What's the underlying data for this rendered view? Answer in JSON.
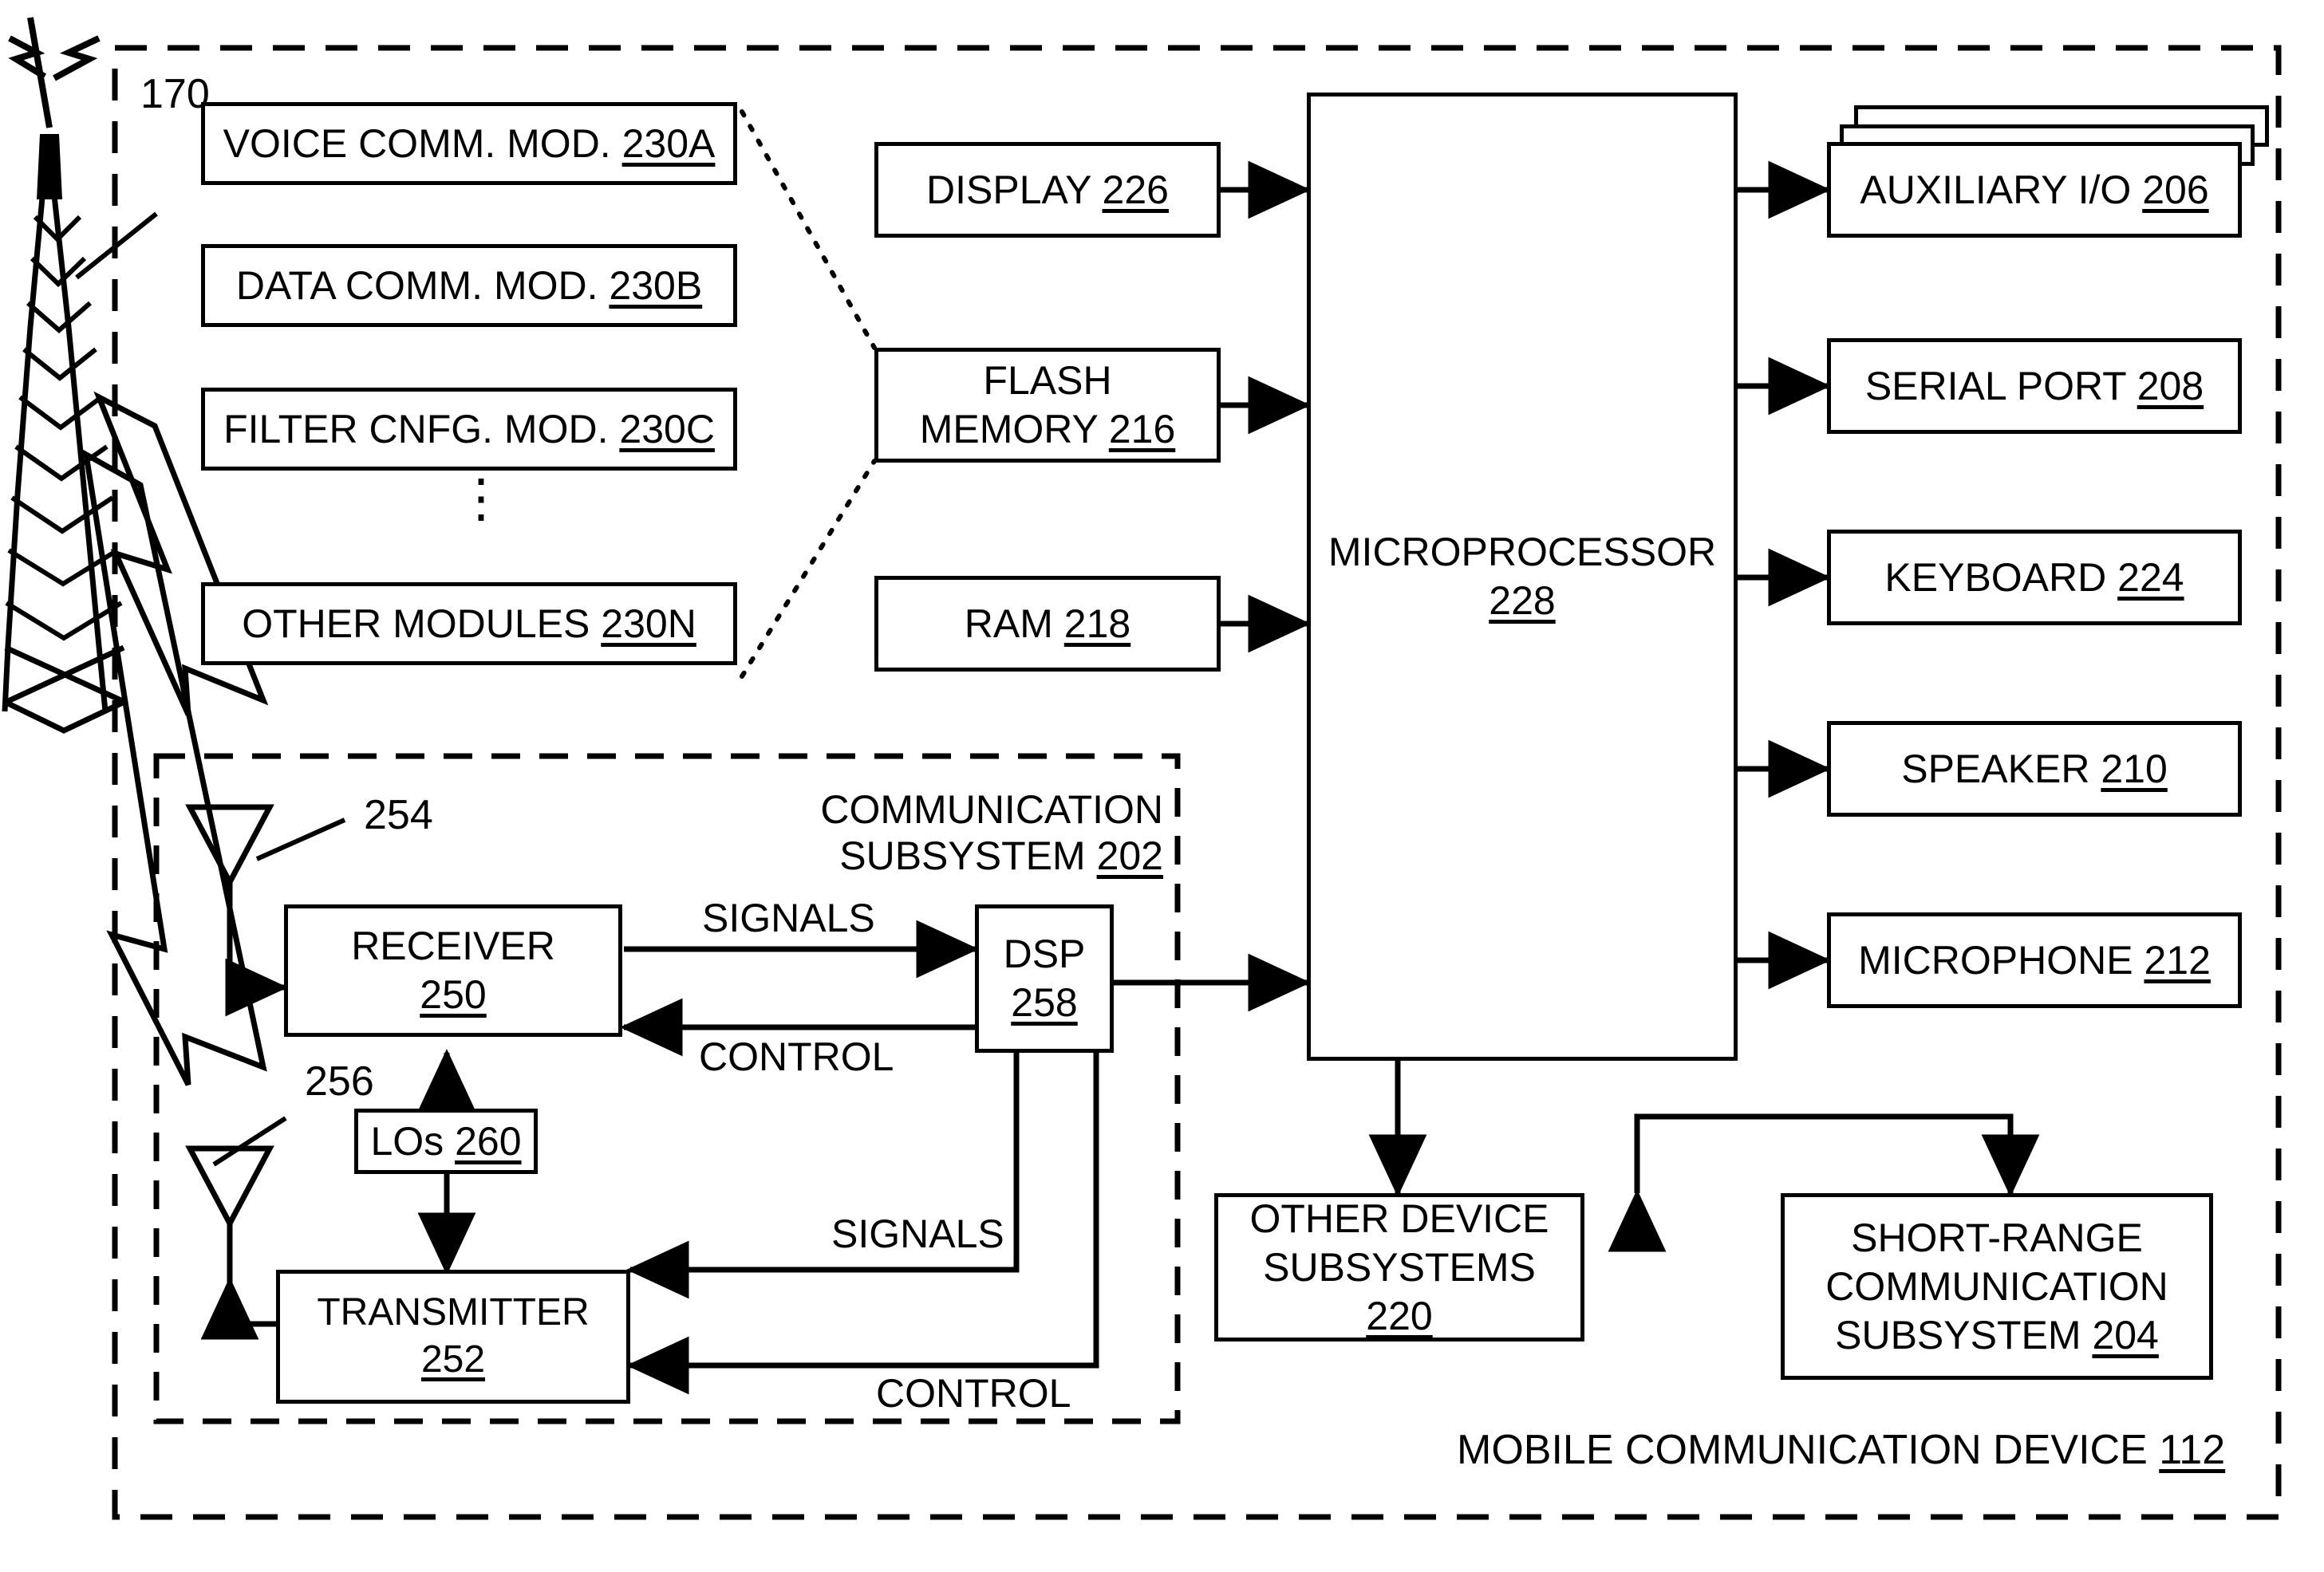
{
  "figure": {
    "outer_device_label": "MOBILE COMMUNICATION DEVICE",
    "outer_device_ref": "112",
    "tower_ref": "170",
    "comm_subsystem_line1": "COMMUNICATION",
    "comm_subsystem_line2": "SUBSYSTEM",
    "comm_subsystem_ref": "202"
  },
  "modules": [
    {
      "label": "VOICE COMM. MOD.",
      "ref": "230A"
    },
    {
      "label": "DATA COMM. MOD.",
      "ref": "230B"
    },
    {
      "label": "FILTER CNFG. MOD.",
      "ref": "230C"
    },
    {
      "label": "OTHER MODULES",
      "ref": "230N"
    }
  ],
  "modules_ellipsis": "⋮",
  "memory_column": [
    {
      "label": "DISPLAY",
      "ref": "226",
      "line2": ""
    },
    {
      "label": "FLASH",
      "line2": "MEMORY",
      "ref": "216"
    },
    {
      "label": "RAM",
      "ref": "218",
      "line2": ""
    }
  ],
  "cpu": {
    "label": "MICROPROCESSOR",
    "ref": "228"
  },
  "peripherals": [
    {
      "label": "AUXILIARY I/O",
      "ref": "206",
      "stacked": true
    },
    {
      "label": "SERIAL PORT",
      "ref": "208",
      "stacked": false
    },
    {
      "label": "KEYBOARD",
      "ref": "224",
      "stacked": false
    },
    {
      "label": "SPEAKER",
      "ref": "210",
      "stacked": false
    },
    {
      "label": "MICROPHONE",
      "ref": "212",
      "stacked": false
    }
  ],
  "bottom_boxes": [
    {
      "line1": "OTHER DEVICE",
      "line2": "SUBSYSTEMS",
      "line3": "",
      "ref": "220"
    },
    {
      "line1": "SHORT-RANGE",
      "line2": "COMMUNICATION",
      "line3": "SUBSYSTEM",
      "ref": "204"
    }
  ],
  "comm": {
    "receiver": {
      "label": "RECEIVER",
      "ref": "250"
    },
    "transmitter": {
      "label": "TRANSMITTER",
      "ref": "252"
    },
    "dsp": {
      "label": "DSP",
      "ref": "258"
    },
    "los": {
      "label": "LOs",
      "ref": "260"
    },
    "antenna_rx_ref": "254",
    "antenna_tx_ref": "256",
    "signals_rx_label": "SIGNALS",
    "control_rx_label": "CONTROL",
    "signals_tx_label": "SIGNALS",
    "control_tx_label": "CONTROL"
  },
  "colors": {
    "ink": "#000000",
    "paper": "#ffffff"
  }
}
